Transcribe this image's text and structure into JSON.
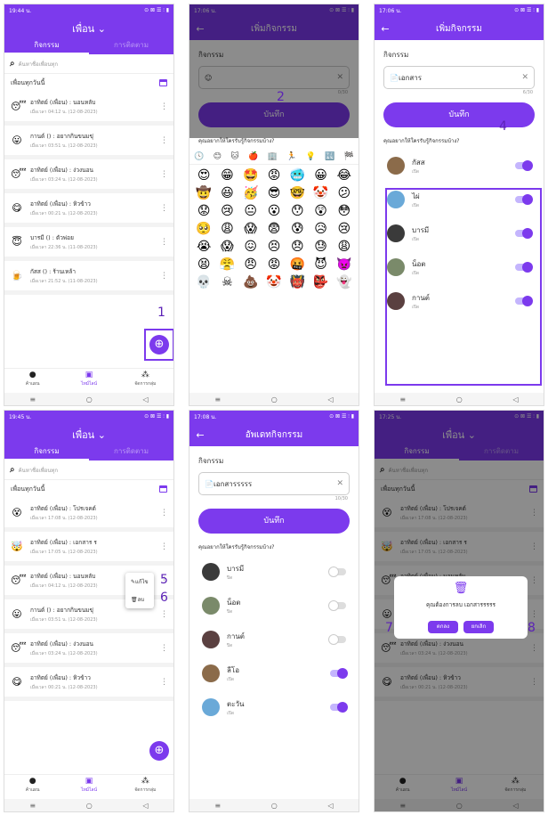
{
  "status": {
    "t1": "19:44 น.",
    "t2": "17:06 น.",
    "t3": "17:06 น.",
    "t4": "19:45 น.",
    "t5": "17:08 น.",
    "t6": "17:25 น.",
    "icons": "⊙ ⊠ ☰ ⫶ ▮"
  },
  "main": {
    "title": "เพื่อน",
    "tab1": "กิจกรรม",
    "tab2": "การติดตาม",
    "search": "ค้นหาชื่อเพื่อนทุก",
    "section": "เพื่อนทุกวันนี้"
  },
  "feed1": [
    {
      "emoji": "😴",
      "t": "อาทิตย์ (เพื่อน) : นอนหลับ",
      "s": "เมื่อเวลา 04:12 น. (12-08-2023)"
    },
    {
      "emoji": "😛",
      "t": "กานต์ () : อยากกินขนมขุ่",
      "s": "เมื่อเวลา 03:51 น. (12-08-2023)"
    },
    {
      "emoji": "😴",
      "t": "อาทิตย์ (เพื่อน) : ง่วงนอน",
      "s": "เมื่อเวลา 03:24 น. (12-08-2023)"
    },
    {
      "emoji": "😋",
      "t": "อาทิตย์ (เพื่อน) : หิวข้าว",
      "s": "เมื่อเวลา 00:21 น. (12-08-2023)"
    },
    {
      "emoji": "😇",
      "t": "บารมี () : ตัวพ่อย",
      "s": "เมื่อเวลา 22:36 น. (11-08-2023)"
    },
    {
      "emoji": "🍺",
      "t": "กัสส () : ร้านเหล้า",
      "s": "เมื่อเวลา 21:52 น. (11-08-2023)"
    }
  ],
  "nav": {
    "a": "ค้าแผน",
    "b": "ไทม์ไลน์",
    "c": "จัดการกลุ่ม"
  },
  "add": {
    "header": "เพิ่มกิจกรรม",
    "label": "กิจกรรม",
    "counter": "0/30",
    "counter2": "6/30",
    "save": "บันทึก",
    "question": "คุณอยากให้ใครรับรู้กิจกรรมบ้าง?",
    "value": "📄เอกสาร"
  },
  "update": {
    "header": "อัพเดทกิจกรรม",
    "value": "📄เอกสารรรรร",
    "counter": "10/30"
  },
  "friends1": [
    {
      "n": "กัสส",
      "s": "เปิด"
    },
    {
      "n": "ไผ่",
      "s": "เปิด"
    },
    {
      "n": "บารมี",
      "s": "เปิด"
    },
    {
      "n": "น็อต",
      "s": "เปิด"
    },
    {
      "n": "กานต์",
      "s": "เปิด"
    }
  ],
  "friends2": [
    {
      "n": "บารมี",
      "s": "ปิด"
    },
    {
      "n": "น็อต",
      "s": "ปิด"
    },
    {
      "n": "กานต์",
      "s": "ปิด"
    },
    {
      "n": "ลีโอ",
      "s": "เปิด"
    },
    {
      "n": "ตะวัน",
      "s": "เปิด"
    }
  ],
  "feed2": [
    {
      "emoji": "😵",
      "t": "อาทิตย์ (เพื่อน) : โปรเจคต์",
      "s": "เมื่อเวลา 17:08 น. (12-08-2023)"
    },
    {
      "emoji": "🤯",
      "t": "อาทิตย์ (เพื่อน) : เอกสาร ร",
      "s": "เมื่อเวลา 17:05 น. (12-08-2023)"
    },
    {
      "emoji": "😴",
      "t": "อาทิตย์ (เพื่อน) : นอนหลับ",
      "s": "เมื่อเวลา 04:12 น. (12-08-2023)"
    },
    {
      "emoji": "😛",
      "t": "กานต์ () : อยากกินขนมขุ่",
      "s": "เมื่อเวลา 03:51 น. (12-08-2023)"
    },
    {
      "emoji": "😴",
      "t": "อาทิตย์ (เพื่อน) : ง่วงนอน",
      "s": "เมื่อเวลา 03:24 น. (12-08-2023)"
    },
    {
      "emoji": "😋",
      "t": "อาทิตย์ (เพื่อน) : หิวข้าว",
      "s": "เมื่อเวลา 00:21 น. (12-08-2023)"
    }
  ],
  "menu": {
    "edit": "แก้ไข",
    "del": "ลบ"
  },
  "dialog": {
    "msg": "คุณต้องการลบ เอกสารรรรร",
    "ok": "ตกลง",
    "cancel": "ยกเลิก"
  },
  "emojis": [
    "😍",
    "😁",
    "🤩",
    "😡",
    "🥶",
    "😀",
    "😂",
    "🤠",
    "😆",
    "🥳",
    "😎",
    "🤓",
    "🤡",
    "😕",
    "😟",
    "😢",
    "😐",
    "😮",
    "😯",
    "😲",
    "😳",
    "🥺",
    "😩",
    "😱",
    "😨",
    "😰",
    "😥",
    "😢",
    "😭",
    "😱",
    "😖",
    "😣",
    "😞",
    "😓",
    "😩",
    "😫",
    "😤",
    "😠",
    "😡",
    "🤬",
    "😈",
    "👿",
    "💀",
    "☠",
    "💩",
    "🤡",
    "👹",
    "👺",
    "👻"
  ],
  "emojiTabs": [
    "🕓",
    "😊",
    "🐱",
    "🍎",
    "🏢",
    "🏃",
    "💡",
    "🔣",
    "🏁"
  ],
  "numbers": {
    "n1": "1",
    "n2": "2",
    "n4": "4",
    "n5": "5",
    "n6": "6",
    "n7": "7",
    "n8": "8"
  },
  "colors": {
    "accent": "#7c3aed"
  }
}
